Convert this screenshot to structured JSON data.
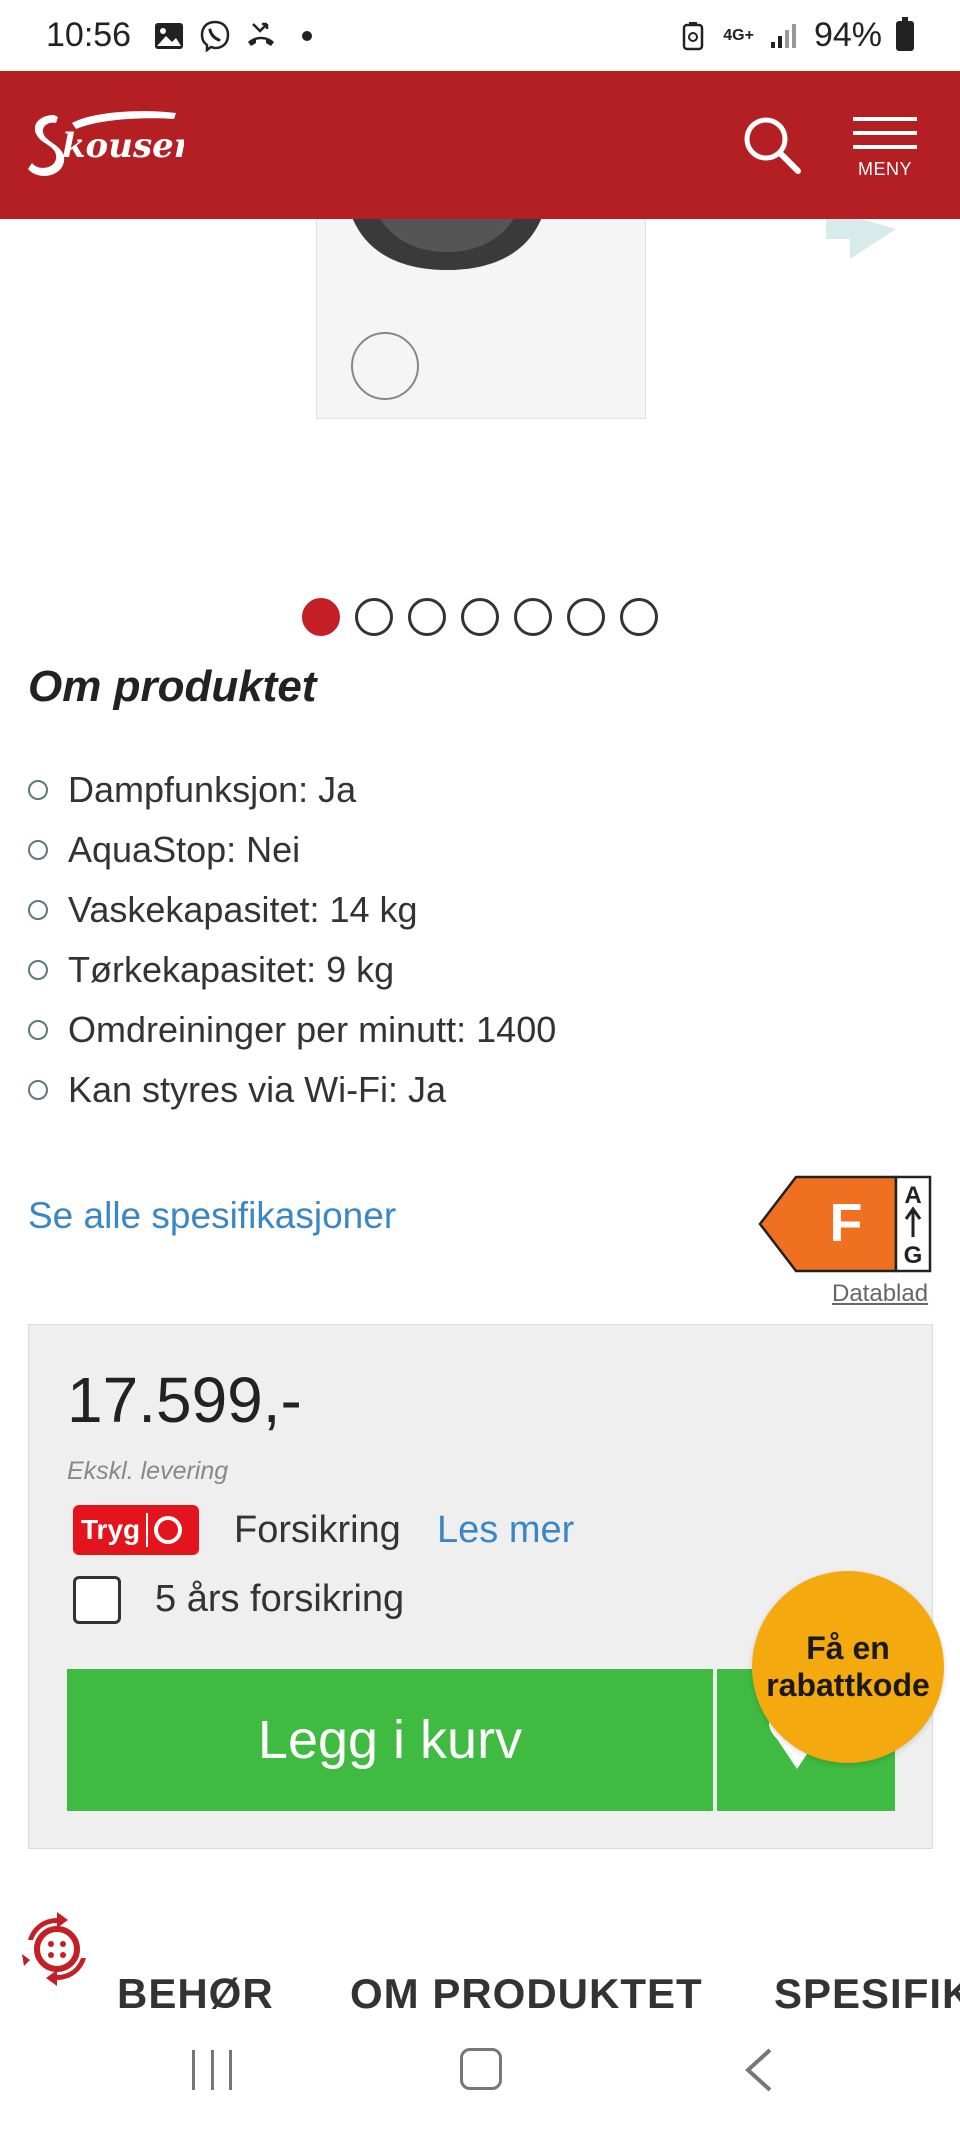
{
  "status_bar": {
    "time": "10:56",
    "network": "4G+",
    "battery": "94%"
  },
  "header": {
    "brand": "Skousen",
    "menu_label": "MENY"
  },
  "gallery": {
    "dot_count": 7,
    "active_index": 0
  },
  "about": {
    "title": "Om produktet",
    "features": [
      "Dampfunksjon: Ja",
      "AquaStop: Nei",
      "Vaskekapasitet: 14 kg",
      "Tørkekapasitet: 9 kg",
      "Omdreininger per minutt: 1400",
      "Kan styres via Wi-Fi: Ja"
    ],
    "spec_link": "Se alle spesifikasjoner"
  },
  "energy": {
    "class": "F",
    "scale_top": "A",
    "scale_bottom": "G",
    "datasheet_link": "Datablad"
  },
  "purchase": {
    "price": "17.599,-",
    "delivery_note": "Ekskl. levering",
    "insurer": "Tryg",
    "insurance_label": "Forsikring",
    "read_more": "Les mer",
    "checkbox_label": "5 års forsikring",
    "add_to_cart": "Legg i kurv"
  },
  "promo": {
    "line1": "Få en",
    "line2": "rabattkode"
  },
  "tabs": [
    "BEHØR",
    "OM PRODUKTET",
    "SPESIFIKA"
  ],
  "colors": {
    "brand_red": "#b41f24",
    "cart_green": "#3fbb41",
    "link_blue": "#3b86c4",
    "promo_yellow": "#f4a90f",
    "energy_orange": "#f07021"
  }
}
